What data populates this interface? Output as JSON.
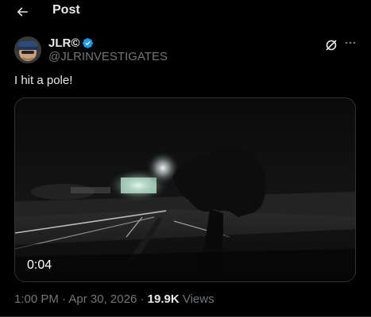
{
  "header": {
    "title": "Post"
  },
  "author": {
    "name": "JLR©",
    "handle": "@JLRINVESTIGATES",
    "verified": true
  },
  "post": {
    "text": "I hit a pole!"
  },
  "media": {
    "type": "video",
    "duration": "0:04"
  },
  "meta": {
    "time": "1:00 PM",
    "separator1": " · ",
    "date": "Apr 30, 2026",
    "separator2": " · ",
    "views_count": "19.9K",
    "views_label": " Views"
  },
  "icons": {
    "back": "arrow-left-icon",
    "verified": "verified-badge-icon",
    "grok": "grok-icon",
    "more": "more-horizontal-icon"
  },
  "colors": {
    "background": "#000000",
    "text_primary": "#e7e9ea",
    "text_secondary": "#71767b",
    "verified_blue": "#1d9bf0",
    "border": "#2f3336"
  }
}
